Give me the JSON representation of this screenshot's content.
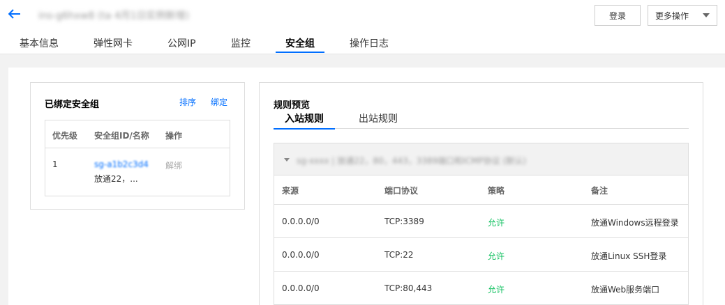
{
  "header": {
    "title": "ins-g6hxw8 (ta 4月1日实例新增)",
    "login_label": "登录",
    "more_label": "更多操作"
  },
  "tabs": [
    {
      "label": "基本信息"
    },
    {
      "label": "弹性网卡"
    },
    {
      "label": "公网IP"
    },
    {
      "label": "监控"
    },
    {
      "label": "安全组",
      "active": true
    },
    {
      "label": "操作日志"
    }
  ],
  "bound": {
    "title": "已绑定安全组",
    "sort_label": "排序",
    "bind_label": "绑定",
    "columns": [
      "优先级",
      "安全组ID/名称",
      "操作"
    ],
    "rows": [
      {
        "priority": "1",
        "sg_id": "sg-a1b2c3d4",
        "sg_name": "放通22，...",
        "action": "解绑"
      }
    ]
  },
  "rules": {
    "title": "规则预览",
    "tabs": [
      {
        "label": "入站规则",
        "active": true
      },
      {
        "label": "出站规则"
      }
    ],
    "group_name": "sg-xxxx | 放通22，80，443，3389端口和ICMP协议 (默认)",
    "columns": [
      "来源",
      "端口协议",
      "策略",
      "备注"
    ],
    "rows": [
      {
        "source": "0.0.0.0/0",
        "port": "TCP:3389",
        "policy": "允许",
        "note": "放通Windows远程登录"
      },
      {
        "source": "0.0.0.0/0",
        "port": "TCP:22",
        "policy": "允许",
        "note": "放通Linux SSH登录"
      },
      {
        "source": "0.0.0.0/0",
        "port": "TCP:80,443",
        "policy": "允许",
        "note": "放通Web服务端口"
      }
    ]
  },
  "colors": {
    "accent": "#006eff",
    "allow": "#0abf5b"
  }
}
